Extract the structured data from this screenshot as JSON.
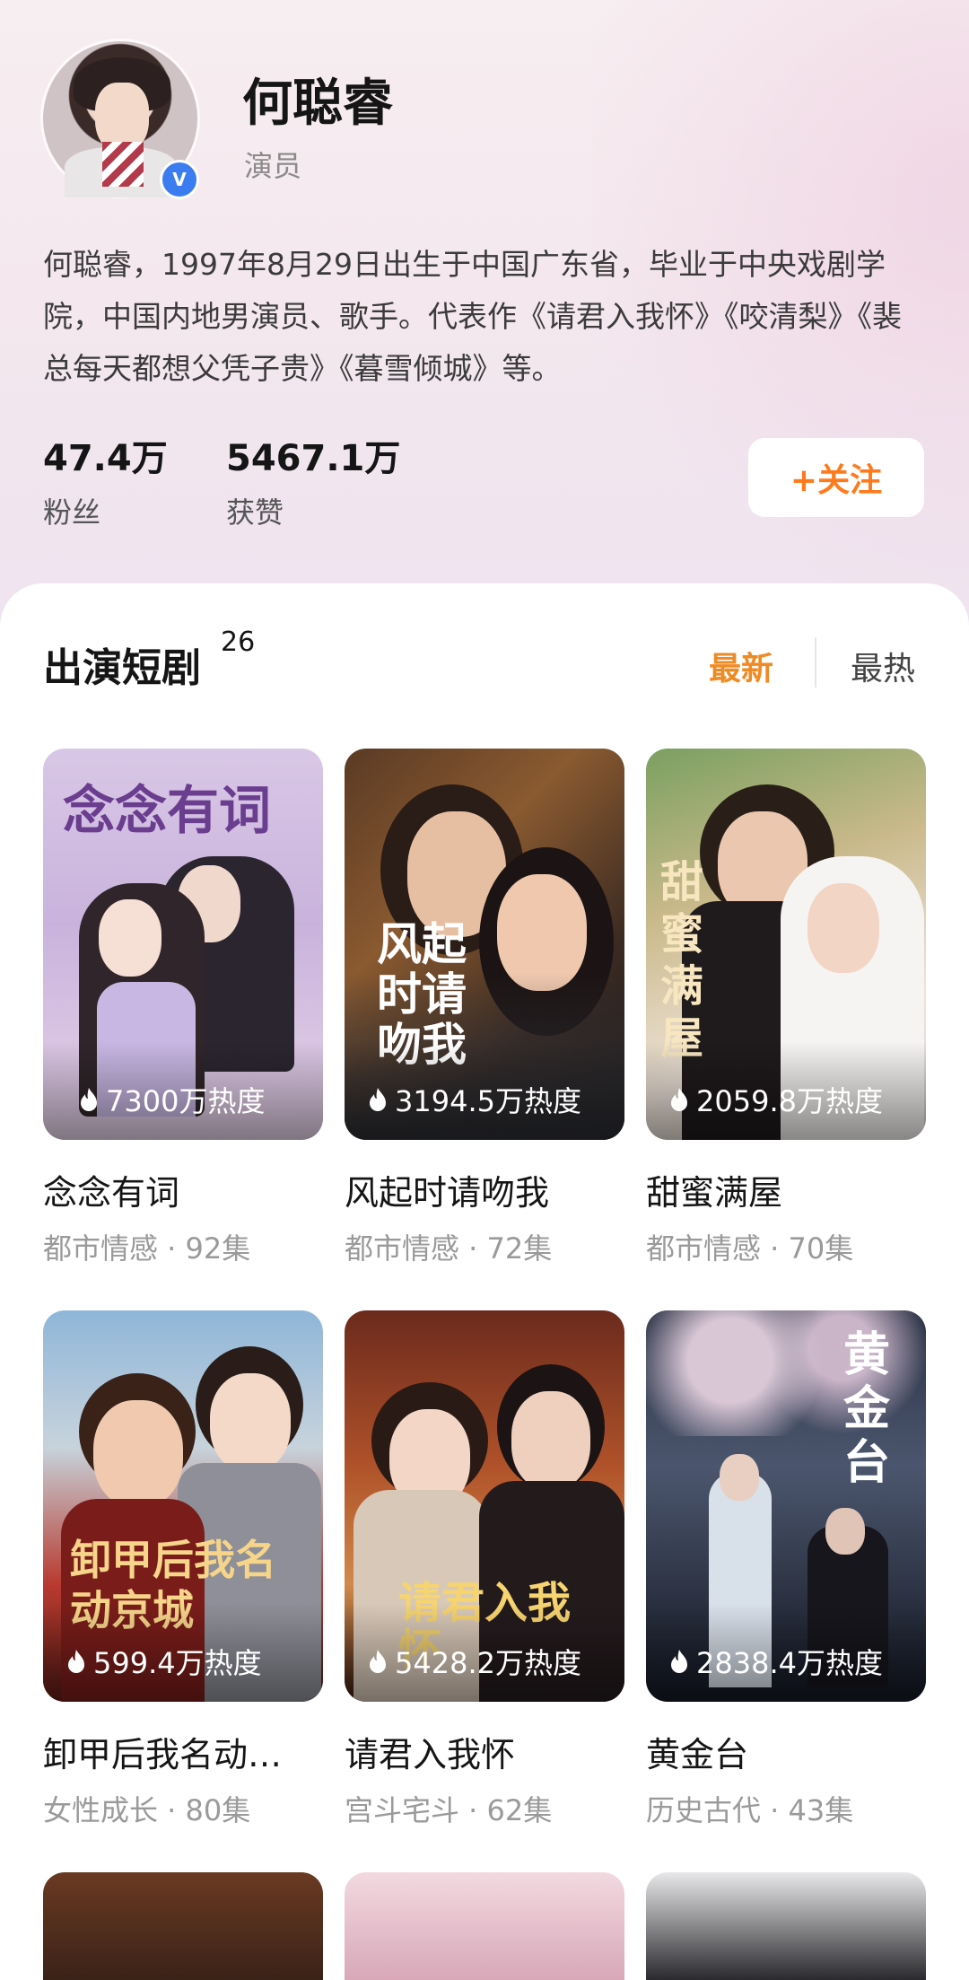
{
  "profile": {
    "name": "何聪睿",
    "role": "演员",
    "verified_mark": "V",
    "bio": "何聪睿，1997年8月29日出生于中国广东省，毕业于中央戏剧学院，中国内地男演员、歌手。代表作《请君入我怀》《咬清梨》《裴总每天都想父凭子贵》《暮雪倾城》等。",
    "stats": [
      {
        "value": "47.4万",
        "label": "粉丝"
      },
      {
        "value": "5467.1万",
        "label": "获赞"
      }
    ],
    "follow_label": "+关注"
  },
  "section": {
    "title": "出演短剧",
    "count": "26",
    "sort_tabs": [
      {
        "label": "最新",
        "active": true
      },
      {
        "label": "最热",
        "active": false
      }
    ]
  },
  "dramas": [
    {
      "title": "念念有词",
      "meta": "都市情感 · 92集",
      "heat": "7300万热度",
      "poster_text": "念念有词"
    },
    {
      "title": "风起时请吻我",
      "meta": "都市情感 · 72集",
      "heat": "3194.5万热度",
      "poster_text": "风起时请吻我"
    },
    {
      "title": "甜蜜满屋",
      "meta": "都市情感 · 70集",
      "heat": "2059.8万热度",
      "poster_text": "甜蜜满屋"
    },
    {
      "title": "卸甲后我名动…",
      "meta": "女性成长 · 80集",
      "heat": "599.4万热度",
      "poster_text": "卸甲后我名动京城"
    },
    {
      "title": "请君入我怀",
      "meta": "宫斗宅斗 · 62集",
      "heat": "5428.2万热度",
      "poster_text": "请君入我怀"
    },
    {
      "title": "黄金台",
      "meta": "历史古代 · 43集",
      "heat": "2838.4万热度",
      "poster_text": "黄金台"
    }
  ],
  "colors": {
    "accent": "#f08a24",
    "follow": "#ff7a1a",
    "verified": "#3b7df0"
  }
}
